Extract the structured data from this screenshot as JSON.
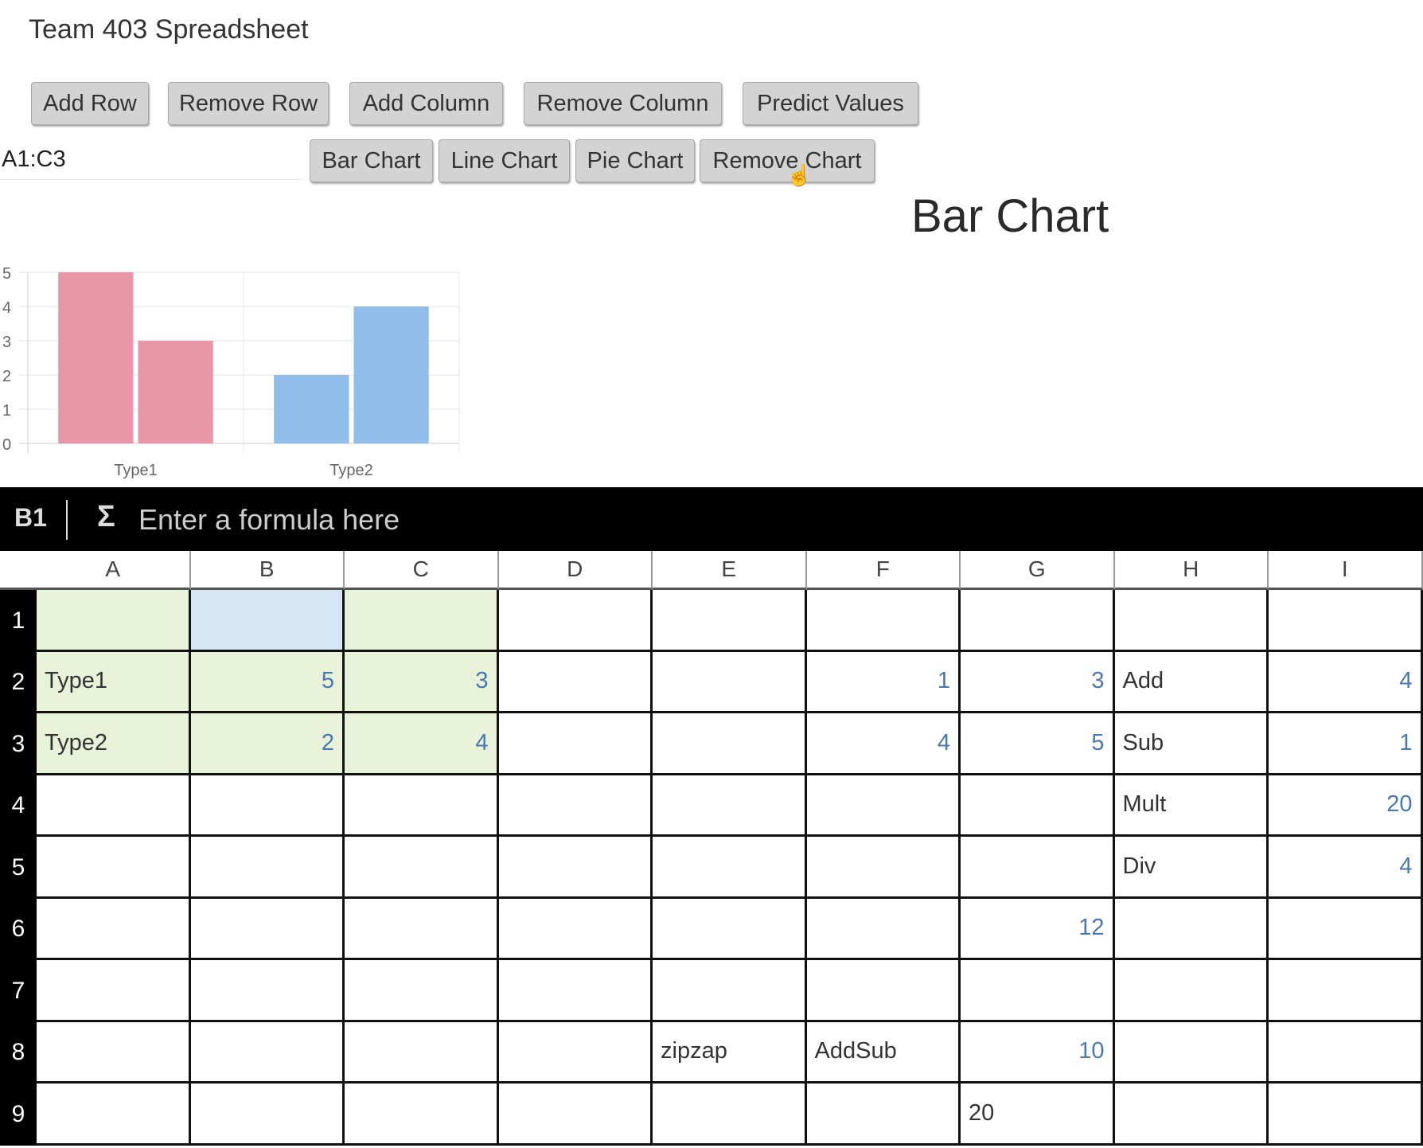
{
  "app": {
    "title": "Team 403 Spreadsheet"
  },
  "toolbar": {
    "row1": [
      {
        "id": "add-row",
        "label": "Add Row"
      },
      {
        "id": "remove-row",
        "label": "Remove Row"
      },
      {
        "id": "add-column",
        "label": "Add Column"
      },
      {
        "id": "remove-column",
        "label": "Remove Column"
      },
      {
        "id": "predict-values",
        "label": "Predict Values"
      }
    ],
    "range_input": {
      "value": "A1:C3"
    },
    "row2": [
      {
        "id": "bar-chart",
        "label": "Bar Chart"
      },
      {
        "id": "line-chart",
        "label": "Line Chart"
      },
      {
        "id": "pie-chart",
        "label": "Pie Chart"
      },
      {
        "id": "remove-chart",
        "label": "Remove Chart"
      }
    ]
  },
  "chart_heading": "Bar Chart",
  "chart_data": {
    "type": "bar",
    "title": "Bar Chart",
    "categories": [
      "Type1",
      "Type2"
    ],
    "series": [
      {
        "category": "Type1",
        "values": [
          5,
          3
        ],
        "color": "#e896a8"
      },
      {
        "category": "Type2",
        "values": [
          2,
          4
        ],
        "color": "#90bdea"
      }
    ],
    "xlabel": "",
    "ylabel": "",
    "ylim": [
      0,
      5
    ],
    "yticks": [
      "0",
      "1",
      "2",
      "3",
      "4",
      "5"
    ],
    "grid": true,
    "legend": "none"
  },
  "formula_bar": {
    "cell_ref": "B1",
    "sigma_icon": "Σ",
    "placeholder": "Enter a formula here",
    "value": ""
  },
  "sheet": {
    "columns": [
      "A",
      "B",
      "C",
      "D",
      "E",
      "F",
      "G",
      "H",
      "I"
    ],
    "rows": [
      "1",
      "2",
      "3",
      "4",
      "5",
      "6",
      "7",
      "8",
      "9"
    ],
    "active_cell": "B1",
    "selected_range": "A1:C3",
    "colors": {
      "range_fill": "#e8f2d8",
      "active_fill": "#d6e6f5",
      "number_text": "#4a78b0"
    },
    "cells": {
      "A2": {
        "v": "Type1",
        "num": false
      },
      "B2": {
        "v": "5",
        "num": true
      },
      "C2": {
        "v": "3",
        "num": true
      },
      "F2": {
        "v": "1",
        "num": true
      },
      "G2": {
        "v": "3",
        "num": true
      },
      "H2": {
        "v": "Add",
        "num": false
      },
      "I2": {
        "v": "4",
        "num": true
      },
      "A3": {
        "v": "Type2",
        "num": false
      },
      "B3": {
        "v": "2",
        "num": true
      },
      "C3": {
        "v": "4",
        "num": true
      },
      "F3": {
        "v": "4",
        "num": true
      },
      "G3": {
        "v": "5",
        "num": true
      },
      "H3": {
        "v": "Sub",
        "num": false
      },
      "I3": {
        "v": "1",
        "num": true
      },
      "H4": {
        "v": "Mult",
        "num": false
      },
      "I4": {
        "v": "20",
        "num": true
      },
      "H5": {
        "v": "Div",
        "num": false
      },
      "I5": {
        "v": "4",
        "num": true
      },
      "G6": {
        "v": "12",
        "num": true
      },
      "E8": {
        "v": "zipzap",
        "num": false
      },
      "F8": {
        "v": "AddSub",
        "num": false
      },
      "G8": {
        "v": "10",
        "num": true
      },
      "G9": {
        "v": "20",
        "num": false
      }
    }
  }
}
